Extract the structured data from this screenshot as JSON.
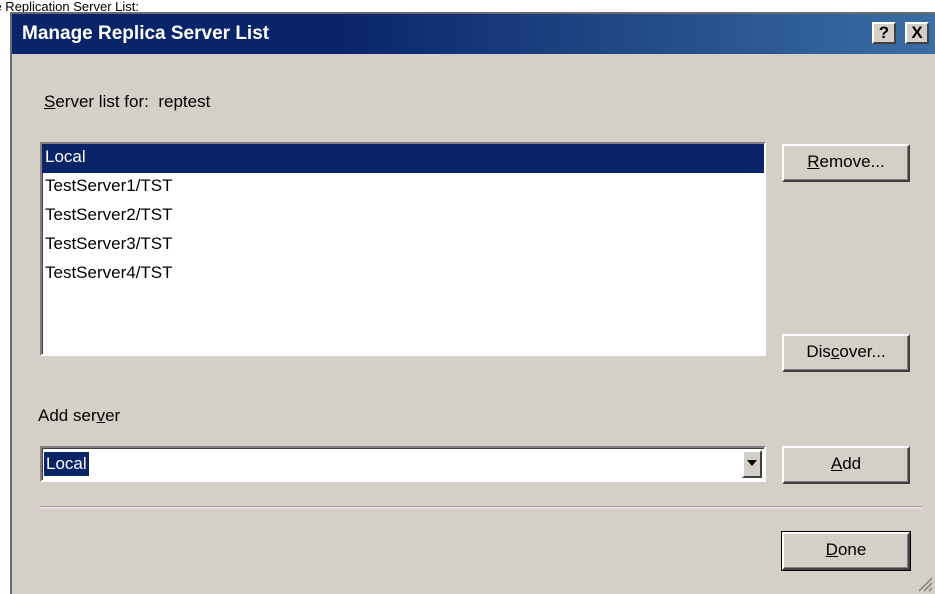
{
  "caption": "age Replication Server List:",
  "window": {
    "title": "Manage Replica Server List",
    "help_label": "?",
    "close_label": "X"
  },
  "server_list": {
    "label_prefix": "Server list for:",
    "label_value": "reptest",
    "items": [
      {
        "label": "Local",
        "selected": true
      },
      {
        "label": "TestServer1/TST",
        "selected": false
      },
      {
        "label": "TestServer2/TST",
        "selected": false
      },
      {
        "label": "TestServer3/TST",
        "selected": false
      },
      {
        "label": "TestServer4/TST",
        "selected": false
      }
    ]
  },
  "buttons": {
    "remove": {
      "before": "",
      "mnemonic": "R",
      "after": "emove..."
    },
    "discover": {
      "before": "Dis",
      "mnemonic": "c",
      "after": "over..."
    },
    "add": {
      "before": "",
      "mnemonic": "A",
      "after": "dd"
    },
    "done": {
      "before": "",
      "mnemonic": "D",
      "after": "one"
    }
  },
  "add_server": {
    "label_before": "Add ser",
    "label_mnemonic": "v",
    "label_after": "er",
    "value": "Local"
  }
}
